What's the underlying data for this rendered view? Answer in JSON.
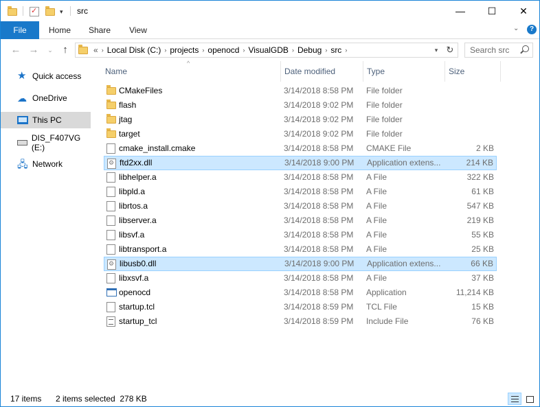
{
  "window": {
    "title": "src",
    "controls": {
      "minimize": "—",
      "maximize": "☐",
      "close": "✕"
    }
  },
  "ribbon": {
    "tabs": [
      "File",
      "Home",
      "Share",
      "View"
    ],
    "expand_icon": "chevron-down-icon",
    "help": "?"
  },
  "address": {
    "overflow": "«",
    "crumbs": [
      "Local Disk (C:)",
      "projects",
      "openocd",
      "VisualGDB",
      "Debug",
      "src"
    ],
    "search_placeholder": "Search src"
  },
  "nav_pane": {
    "items": [
      {
        "label": "Quick access",
        "icon": "star-icon"
      },
      {
        "label": "OneDrive",
        "icon": "cloud-icon"
      },
      {
        "label": "This PC",
        "icon": "computer-icon",
        "selected": true
      },
      {
        "label": "DIS_F407VG (E:)",
        "icon": "drive-icon"
      },
      {
        "label": "Network",
        "icon": "network-icon"
      }
    ]
  },
  "columns": {
    "name": "Name",
    "date": "Date modified",
    "type": "Type",
    "size": "Size"
  },
  "files": [
    {
      "name": "CMakeFiles",
      "date": "3/14/2018 8:58 PM",
      "type": "File folder",
      "size": "",
      "icon": "folder",
      "selected": false
    },
    {
      "name": "flash",
      "date": "3/14/2018 9:02 PM",
      "type": "File folder",
      "size": "",
      "icon": "folder",
      "selected": false
    },
    {
      "name": "jtag",
      "date": "3/14/2018 9:02 PM",
      "type": "File folder",
      "size": "",
      "icon": "folder",
      "selected": false
    },
    {
      "name": "target",
      "date": "3/14/2018 9:02 PM",
      "type": "File folder",
      "size": "",
      "icon": "folder",
      "selected": false
    },
    {
      "name": "cmake_install.cmake",
      "date": "3/14/2018 8:58 PM",
      "type": "CMAKE File",
      "size": "2 KB",
      "icon": "doc",
      "selected": false
    },
    {
      "name": "ftd2xx.dll",
      "date": "3/14/2018 9:00 PM",
      "type": "Application extens...",
      "size": "214 KB",
      "icon": "dll",
      "selected": true
    },
    {
      "name": "libhelper.a",
      "date": "3/14/2018 8:58 PM",
      "type": "A File",
      "size": "322 KB",
      "icon": "doc",
      "selected": false
    },
    {
      "name": "libpld.a",
      "date": "3/14/2018 8:58 PM",
      "type": "A File",
      "size": "61 KB",
      "icon": "doc",
      "selected": false
    },
    {
      "name": "librtos.a",
      "date": "3/14/2018 8:58 PM",
      "type": "A File",
      "size": "547 KB",
      "icon": "doc",
      "selected": false
    },
    {
      "name": "libserver.a",
      "date": "3/14/2018 8:58 PM",
      "type": "A File",
      "size": "219 KB",
      "icon": "doc",
      "selected": false
    },
    {
      "name": "libsvf.a",
      "date": "3/14/2018 8:58 PM",
      "type": "A File",
      "size": "55 KB",
      "icon": "doc",
      "selected": false
    },
    {
      "name": "libtransport.a",
      "date": "3/14/2018 8:58 PM",
      "type": "A File",
      "size": "25 KB",
      "icon": "doc",
      "selected": false
    },
    {
      "name": "libusb0.dll",
      "date": "3/14/2018 9:00 PM",
      "type": "Application extens...",
      "size": "66 KB",
      "icon": "dll",
      "selected": true
    },
    {
      "name": "libxsvf.a",
      "date": "3/14/2018 8:58 PM",
      "type": "A File",
      "size": "37 KB",
      "icon": "doc",
      "selected": false
    },
    {
      "name": "openocd",
      "date": "3/14/2018 8:58 PM",
      "type": "Application",
      "size": "11,214 KB",
      "icon": "app",
      "selected": false
    },
    {
      "name": "startup.tcl",
      "date": "3/14/2018 8:59 PM",
      "type": "TCL File",
      "size": "15 KB",
      "icon": "doc",
      "selected": false
    },
    {
      "name": "startup_tcl",
      "date": "3/14/2018 8:59 PM",
      "type": "Include File",
      "size": "76 KB",
      "icon": "tcl",
      "selected": false
    }
  ],
  "status": {
    "item_count": "17 items",
    "selection": "2 items selected  278 KB"
  },
  "colors": {
    "accent": "#1979ca",
    "selection_bg": "#cce8ff",
    "selection_border": "#99d1ff",
    "header_text": "#4c607a"
  }
}
